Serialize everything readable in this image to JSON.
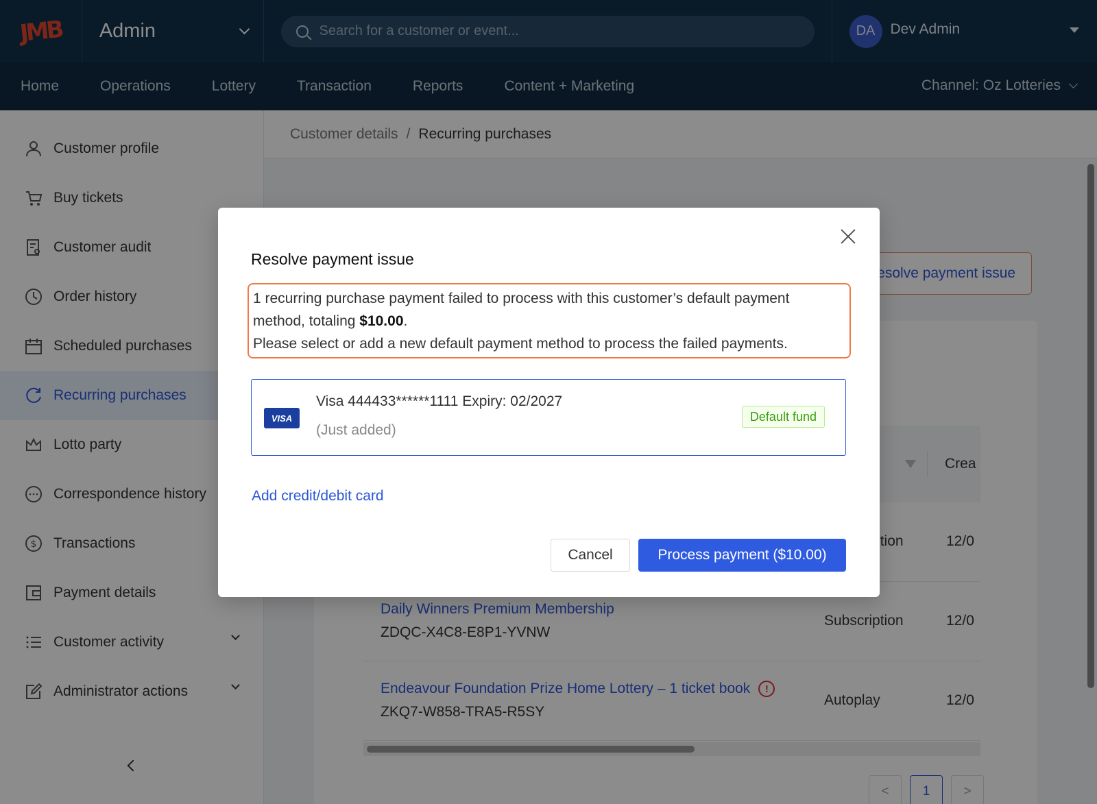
{
  "header": {
    "logo_text": "JMB",
    "app_title": "Admin",
    "search_placeholder": "Search for a customer or event...",
    "user_initials": "DA",
    "user_name": "Dev Admin"
  },
  "nav": {
    "items": [
      "Home",
      "Operations",
      "Lottery",
      "Transaction",
      "Reports",
      "Content + Marketing"
    ],
    "channel": "Channel: Oz Lotteries"
  },
  "sidebar": {
    "items": [
      {
        "label": "Customer profile",
        "icon": "user-icon"
      },
      {
        "label": "Buy tickets",
        "icon": "cart-icon"
      },
      {
        "label": "Customer audit",
        "icon": "audit-icon"
      },
      {
        "label": "Order history",
        "icon": "clock-icon"
      },
      {
        "label": "Scheduled purchases",
        "icon": "calendar-icon"
      },
      {
        "label": "Recurring purchases",
        "icon": "refresh-icon",
        "active": true
      },
      {
        "label": "Lotto party",
        "icon": "crown-icon"
      },
      {
        "label": "Correspondence history",
        "icon": "chat-icon"
      },
      {
        "label": "Transactions",
        "icon": "dollar-icon"
      },
      {
        "label": "Payment details",
        "icon": "wallet-icon"
      },
      {
        "label": "Customer activity",
        "icon": "list-icon",
        "expandable": true
      },
      {
        "label": "Administrator actions",
        "icon": "edit-icon",
        "expandable": true
      }
    ]
  },
  "breadcrumb": {
    "parent": "Customer details",
    "separator": "/",
    "current": "Recurring purchases"
  },
  "background": {
    "resolve_button_label": "Resolve payment issue",
    "table_header_partial": "Crea",
    "rows": [
      {
        "name": "",
        "code": "",
        "type": "Subscription",
        "date": "12/0"
      },
      {
        "name": "Daily Winners Premium Membership",
        "code": "ZDQC-X4C8-E8P1-YVNW",
        "type": "Subscription",
        "date": "12/0"
      },
      {
        "name": "Endeavour Foundation Prize Home Lottery – 1 ticket book",
        "code": "ZKQ7-W858-TRA5-R5SY",
        "type": "Autoplay",
        "date": "12/0",
        "warning": true
      }
    ],
    "pagination": {
      "prev": "<",
      "current": "1",
      "next": ">"
    }
  },
  "modal": {
    "title": "Resolve payment issue",
    "alert_line1": "1 recurring purchase payment failed to process with this customer’s default payment",
    "alert_line2_prefix": "method, totaling ",
    "alert_amount": "$10.00",
    "alert_line2_suffix": ".",
    "alert_line3": "Please select or add a new default payment method to process the failed payments.",
    "card": {
      "brand": "VISA",
      "label": "Visa 444433******1111 Expiry: 02/2027",
      "sublabel": "(Just added)",
      "tag": "Default fund"
    },
    "add_card_link": "Add credit/debit card",
    "cancel_label": "Cancel",
    "process_label": "Process payment ($10.00)"
  },
  "colors": {
    "header_bg": "#12304a",
    "nav_bg": "#0f2a40",
    "primary": "#2f5be0",
    "link": "#2b57d6",
    "alert_border": "#ee7a46",
    "tag_green": "#389e0d",
    "error_red": "#e03131"
  }
}
